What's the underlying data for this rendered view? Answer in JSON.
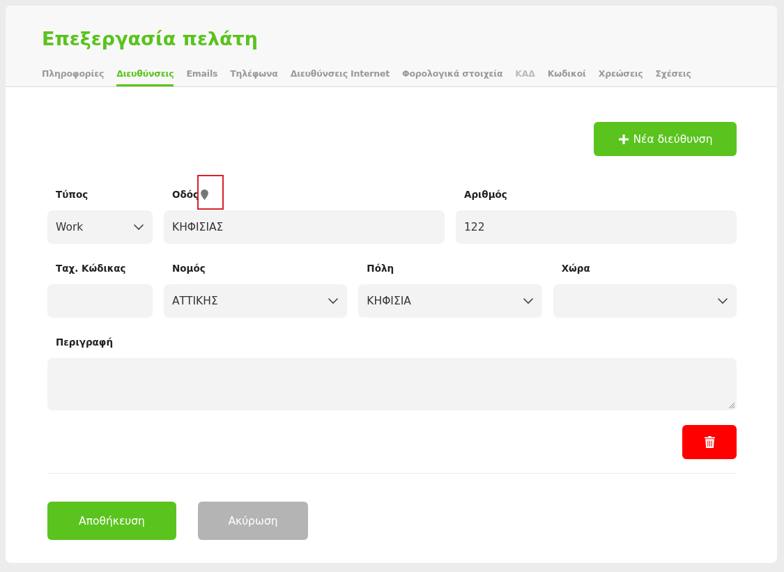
{
  "title": "Επεξεργασία πελάτη",
  "tabs": [
    {
      "label": "Πληροφορίες",
      "selected": false,
      "disabled": false
    },
    {
      "label": "Διευθύνσεις",
      "selected": true,
      "disabled": false
    },
    {
      "label": "Emails",
      "selected": false,
      "disabled": false
    },
    {
      "label": "Τηλέφωνα",
      "selected": false,
      "disabled": false
    },
    {
      "label": "Διευθύνσεις Internet",
      "selected": false,
      "disabled": false
    },
    {
      "label": "Φορολογικά στοιχεία",
      "selected": false,
      "disabled": false
    },
    {
      "label": "ΚΑΔ",
      "selected": false,
      "disabled": true
    },
    {
      "label": "Κωδικοί",
      "selected": false,
      "disabled": false
    },
    {
      "label": "Χρεώσεις",
      "selected": false,
      "disabled": false
    },
    {
      "label": "Σχέσεις",
      "selected": false,
      "disabled": false
    }
  ],
  "new_address_button": "Νέα διεύθυνση",
  "field_rows": [
    [
      {
        "kind": "select",
        "label": "Τύπος",
        "value": "Work"
      },
      {
        "kind": "text",
        "label": "Οδός",
        "value": "ΚΗΦΙΣΙΑΣ",
        "pin": true,
        "pin_highlighted": true
      },
      {
        "kind": "text",
        "label": "Αριθμός",
        "value": "122"
      }
    ],
    [
      {
        "kind": "text",
        "label": "Ταχ. Κώδικας"
      },
      {
        "kind": "select",
        "label": "Νομός",
        "value": "ΑΤΤΙΚΗΣ"
      },
      {
        "kind": "select",
        "label": "Πόλη",
        "value": "ΚΗΦΙΣΙΑ"
      },
      {
        "kind": "select",
        "label": "Χώρα"
      }
    ],
    [
      {
        "kind": "textarea",
        "label": "Περιγραφή"
      }
    ]
  ],
  "footer_buttons": [
    {
      "kind": "primary",
      "label": "Αποθήκευση"
    },
    {
      "kind": "secondary",
      "label": "Ακύρωση"
    }
  ]
}
